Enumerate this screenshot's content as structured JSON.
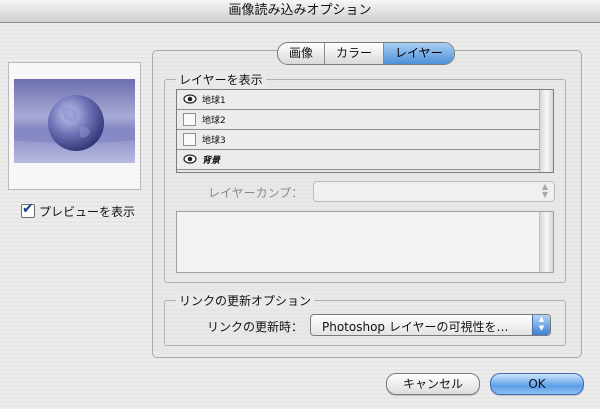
{
  "window": {
    "title": "画像読み込みオプション"
  },
  "preview": {
    "checkbox_label": "プレビューを表示",
    "checked": true
  },
  "tabs": [
    {
      "label": "画像",
      "active": false
    },
    {
      "label": "カラー",
      "active": false
    },
    {
      "label": "レイヤー",
      "active": true
    }
  ],
  "layers_group": {
    "title": "レイヤーを表示",
    "layers": [
      {
        "name": "地球1",
        "visible": true,
        "icon": "eye-icon"
      },
      {
        "name": "地球2",
        "visible": false
      },
      {
        "name": "地球3",
        "visible": false
      },
      {
        "name": "背景",
        "visible": true,
        "icon": "eye-icon"
      }
    ],
    "comp_label": "レイヤーカンプ：",
    "comp_value": ""
  },
  "link_group": {
    "title": "リンクの更新オプション",
    "update_label": "リンクの更新時：",
    "update_value": "Photoshop レイヤーの可視性を…"
  },
  "buttons": {
    "cancel": "キャンセル",
    "ok": "OK"
  },
  "colors": {
    "accent": "#4f8fd8",
    "background": "#ececec"
  }
}
